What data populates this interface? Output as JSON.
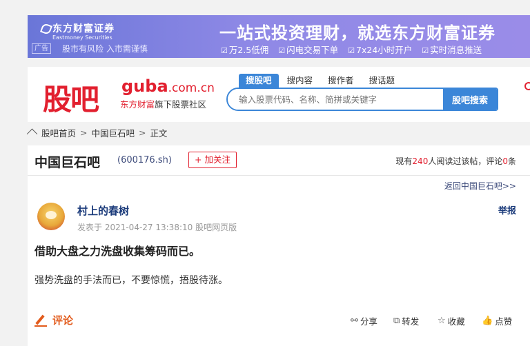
{
  "banner": {
    "logo_cn": "东方财富证券",
    "logo_en": "Eastmoney Securities",
    "ad_tag": "广告",
    "risk": "股市有风险 入市需谨慎",
    "slogan": "一站式投资理财，就选东方财富证券",
    "features": [
      "万2.5低佣",
      "闪电交易下单",
      "7x24小时开户",
      "实时消息推送"
    ]
  },
  "header": {
    "brand": "股吧",
    "guba": "guba",
    "domain": ".com.cn",
    "sub_brand": "东方财富",
    "sub_text": "旗下股票社区",
    "tabs": [
      "搜股吧",
      "搜内容",
      "搜作者",
      "搜话题"
    ],
    "search_placeholder": "输入股票代码、名称、简拼或关键字",
    "search_button": "股吧搜索"
  },
  "breadcrumb": {
    "home": "股吧首页",
    "bar": "中国巨石吧",
    "current": "正文",
    "sep": ">"
  },
  "post": {
    "bar_name": "中国巨石吧",
    "bar_code": "(600176.sh)",
    "follow": "+ 加关注",
    "stats_prefix": "现有",
    "readers": "240",
    "stats_mid": "人阅读过该帖，评论",
    "comments": "0",
    "stats_suffix": "条",
    "return_link": "返回中国巨石吧>>",
    "author": "村上的春树",
    "report": "举报",
    "meta": "发表于 2021-04-27 13:38:10 股吧网页版",
    "title": "借助大盘之力洗盘收集筹码而已。",
    "body": "强势洗盘的手法而已，不要惊慌，捂股待涨。",
    "comment_label": "评论",
    "actions": {
      "share": "分享",
      "repost": "转发",
      "collect": "收藏",
      "like": "点赞"
    }
  }
}
